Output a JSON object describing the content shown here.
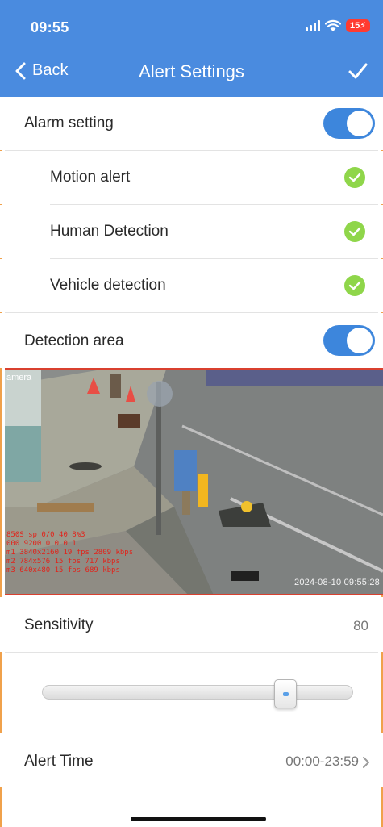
{
  "status_bar": {
    "time": "09:55",
    "battery": "15"
  },
  "nav": {
    "back_label": "Back",
    "title": "Alert Settings"
  },
  "alarm_setting": {
    "label": "Alarm setting",
    "enabled": true
  },
  "detections": [
    {
      "label": "Motion alert",
      "checked": true
    },
    {
      "label": "Human Detection",
      "checked": true
    },
    {
      "label": "Vehicle detection",
      "checked": true
    }
  ],
  "detection_area": {
    "label": "Detection area",
    "enabled": true
  },
  "camera": {
    "label": "amera",
    "timestamp": "2024-08-10 09:55:28",
    "overlay_lines": [
      "850S sp 0/0 40 8%3",
      "000 9200 0 0 0 1",
      "m1 3840x2160 19 fps 2809 kbps",
      "m2 784x576 15 fps 717 kbps",
      "m3 640x480 15 fps 689 kbps"
    ]
  },
  "sensitivity": {
    "label": "Sensitivity",
    "value": "80",
    "level": 80
  },
  "alert_time": {
    "label": "Alert Time",
    "value": "00:00-23:59"
  },
  "colors": {
    "header": "#4a8bdf",
    "toggle": "#3d86dc",
    "check": "#8fd64a"
  },
  "icons": [
    "back-chevron-icon",
    "checkmark-icon",
    "signal-icon",
    "wifi-icon",
    "battery-icon",
    "check-circle-icon",
    "chevron-right-icon"
  ]
}
